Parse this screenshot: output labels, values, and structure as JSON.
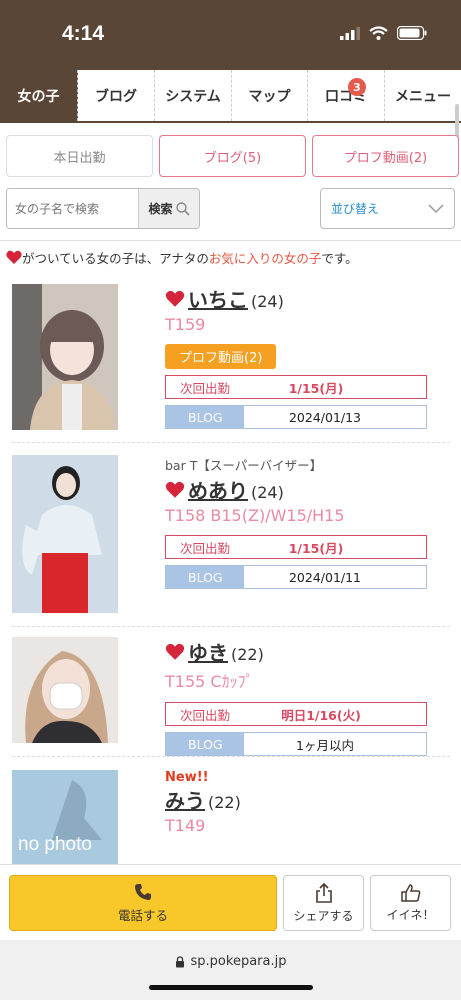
{
  "status_bar": {
    "time": "4:14"
  },
  "nav": {
    "tabs": [
      {
        "label": "女の子"
      },
      {
        "label": "ブログ"
      },
      {
        "label": "システム"
      },
      {
        "label": "マップ"
      },
      {
        "label": "口コミ",
        "badge": "3"
      },
      {
        "label": "メニュー"
      }
    ]
  },
  "filters": {
    "today": "本日出勤",
    "blog": "ブログ(5)",
    "video": "プロフ動画(2)"
  },
  "search": {
    "placeholder": "女の子名で検索",
    "button": "検索",
    "sort_label": "並び替え"
  },
  "favorite_note": {
    "prefix": "がついている女の子は、アナタの",
    "highlight": "お気に入りの女の子",
    "suffix": "です。"
  },
  "girls": [
    {
      "name": "いちこ",
      "age": "(24)",
      "spec": "T159",
      "video_button": "プロフ動画(2)",
      "next_label": "次回出勤",
      "next_date": "1/15(月)",
      "blog_label": "BLOG",
      "blog_date": "2024/01/13"
    },
    {
      "role": "bar T【スーパーバイザー】",
      "name": "めあり",
      "age": "(24)",
      "spec": "T158 B15(Z)/W15/H15",
      "next_label": "次回出勤",
      "next_date": "1/15(月)",
      "blog_label": "BLOG",
      "blog_date": "2024/01/11"
    },
    {
      "name": "ゆき",
      "age": "(22)",
      "spec": "T155 Cｶｯﾌﾟ",
      "next_label": "次回出勤",
      "next_date": "明日1/16(火)",
      "blog_label": "BLOG",
      "blog_date": "1ヶ月以内"
    },
    {
      "new_tag": "New!!",
      "name": "みう",
      "age": "(22)",
      "spec": "T149",
      "photo_text": "no photo"
    }
  ],
  "bottom_bar": {
    "call": "電話する",
    "share": "シェアする",
    "like": "イイネ！"
  },
  "url": "sp.pokepara.jp",
  "colors": {
    "brand_brown": "#5a4636",
    "accent_pink": "#e15f77",
    "call_yellow": "#f8c72a",
    "video_orange": "#f6a021",
    "blog_blue": "#aac4e6"
  }
}
